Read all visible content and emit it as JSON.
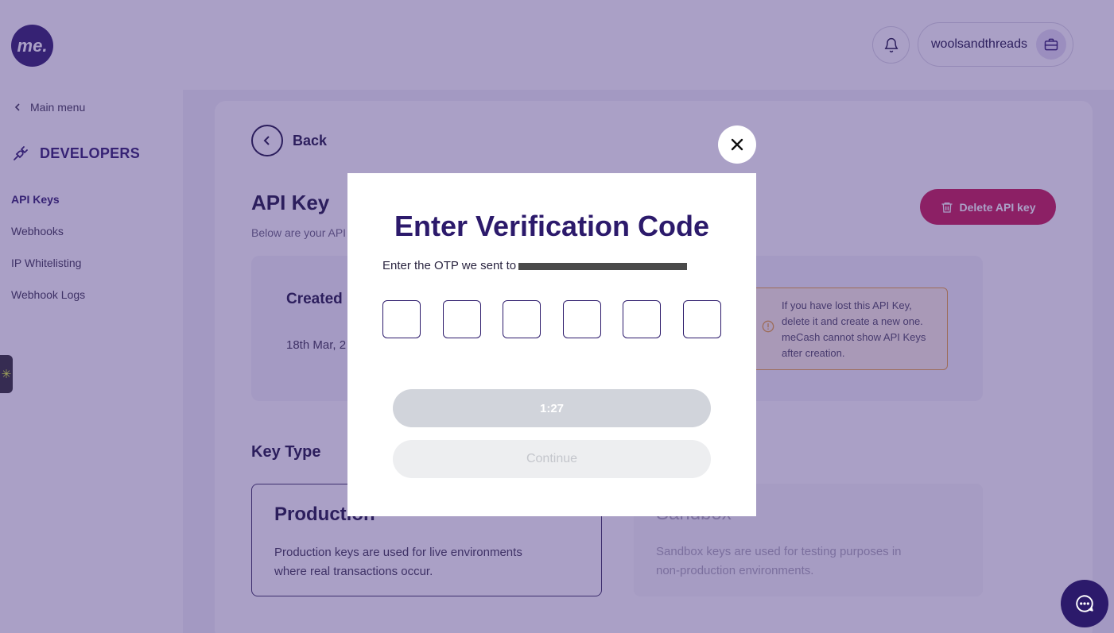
{
  "header": {
    "logo_text": "me.",
    "account_name": "woolsandthreads"
  },
  "sidebar": {
    "main_menu": "Main menu",
    "section_title": "DEVELOPERS",
    "items": [
      {
        "label": "API Keys"
      },
      {
        "label": "Webhooks"
      },
      {
        "label": "IP Whitelisting"
      },
      {
        "label": "Webhook Logs"
      }
    ]
  },
  "page": {
    "back_label": "Back",
    "title": "API Key",
    "subtitle": "Below are your API",
    "delete_label": "Delete API key",
    "created_label": "Created",
    "created_date": "18th Mar, 2",
    "warning": "If you have lost this API Key, delete it and create a new one. meCash cannot show API Keys after creation.",
    "key_type_label": "Key Type",
    "options": [
      {
        "title": "Production",
        "desc": "Production keys are used for live environments where real transactions occur."
      },
      {
        "title": "Sandbox",
        "desc": "Sandbox keys are used for testing purposes in non-production environments."
      }
    ]
  },
  "modal": {
    "title": "Enter Verification Code",
    "instruction": "Enter the OTP we sent to",
    "otp_values": [
      "",
      "",
      "",
      "",
      "",
      ""
    ],
    "timer": "1:27",
    "continue_label": "Continue"
  },
  "colors": {
    "brand": "#2c1a6b",
    "danger": "#c8174f",
    "overlay": "#422d80",
    "warning_border": "#e8a13a"
  }
}
